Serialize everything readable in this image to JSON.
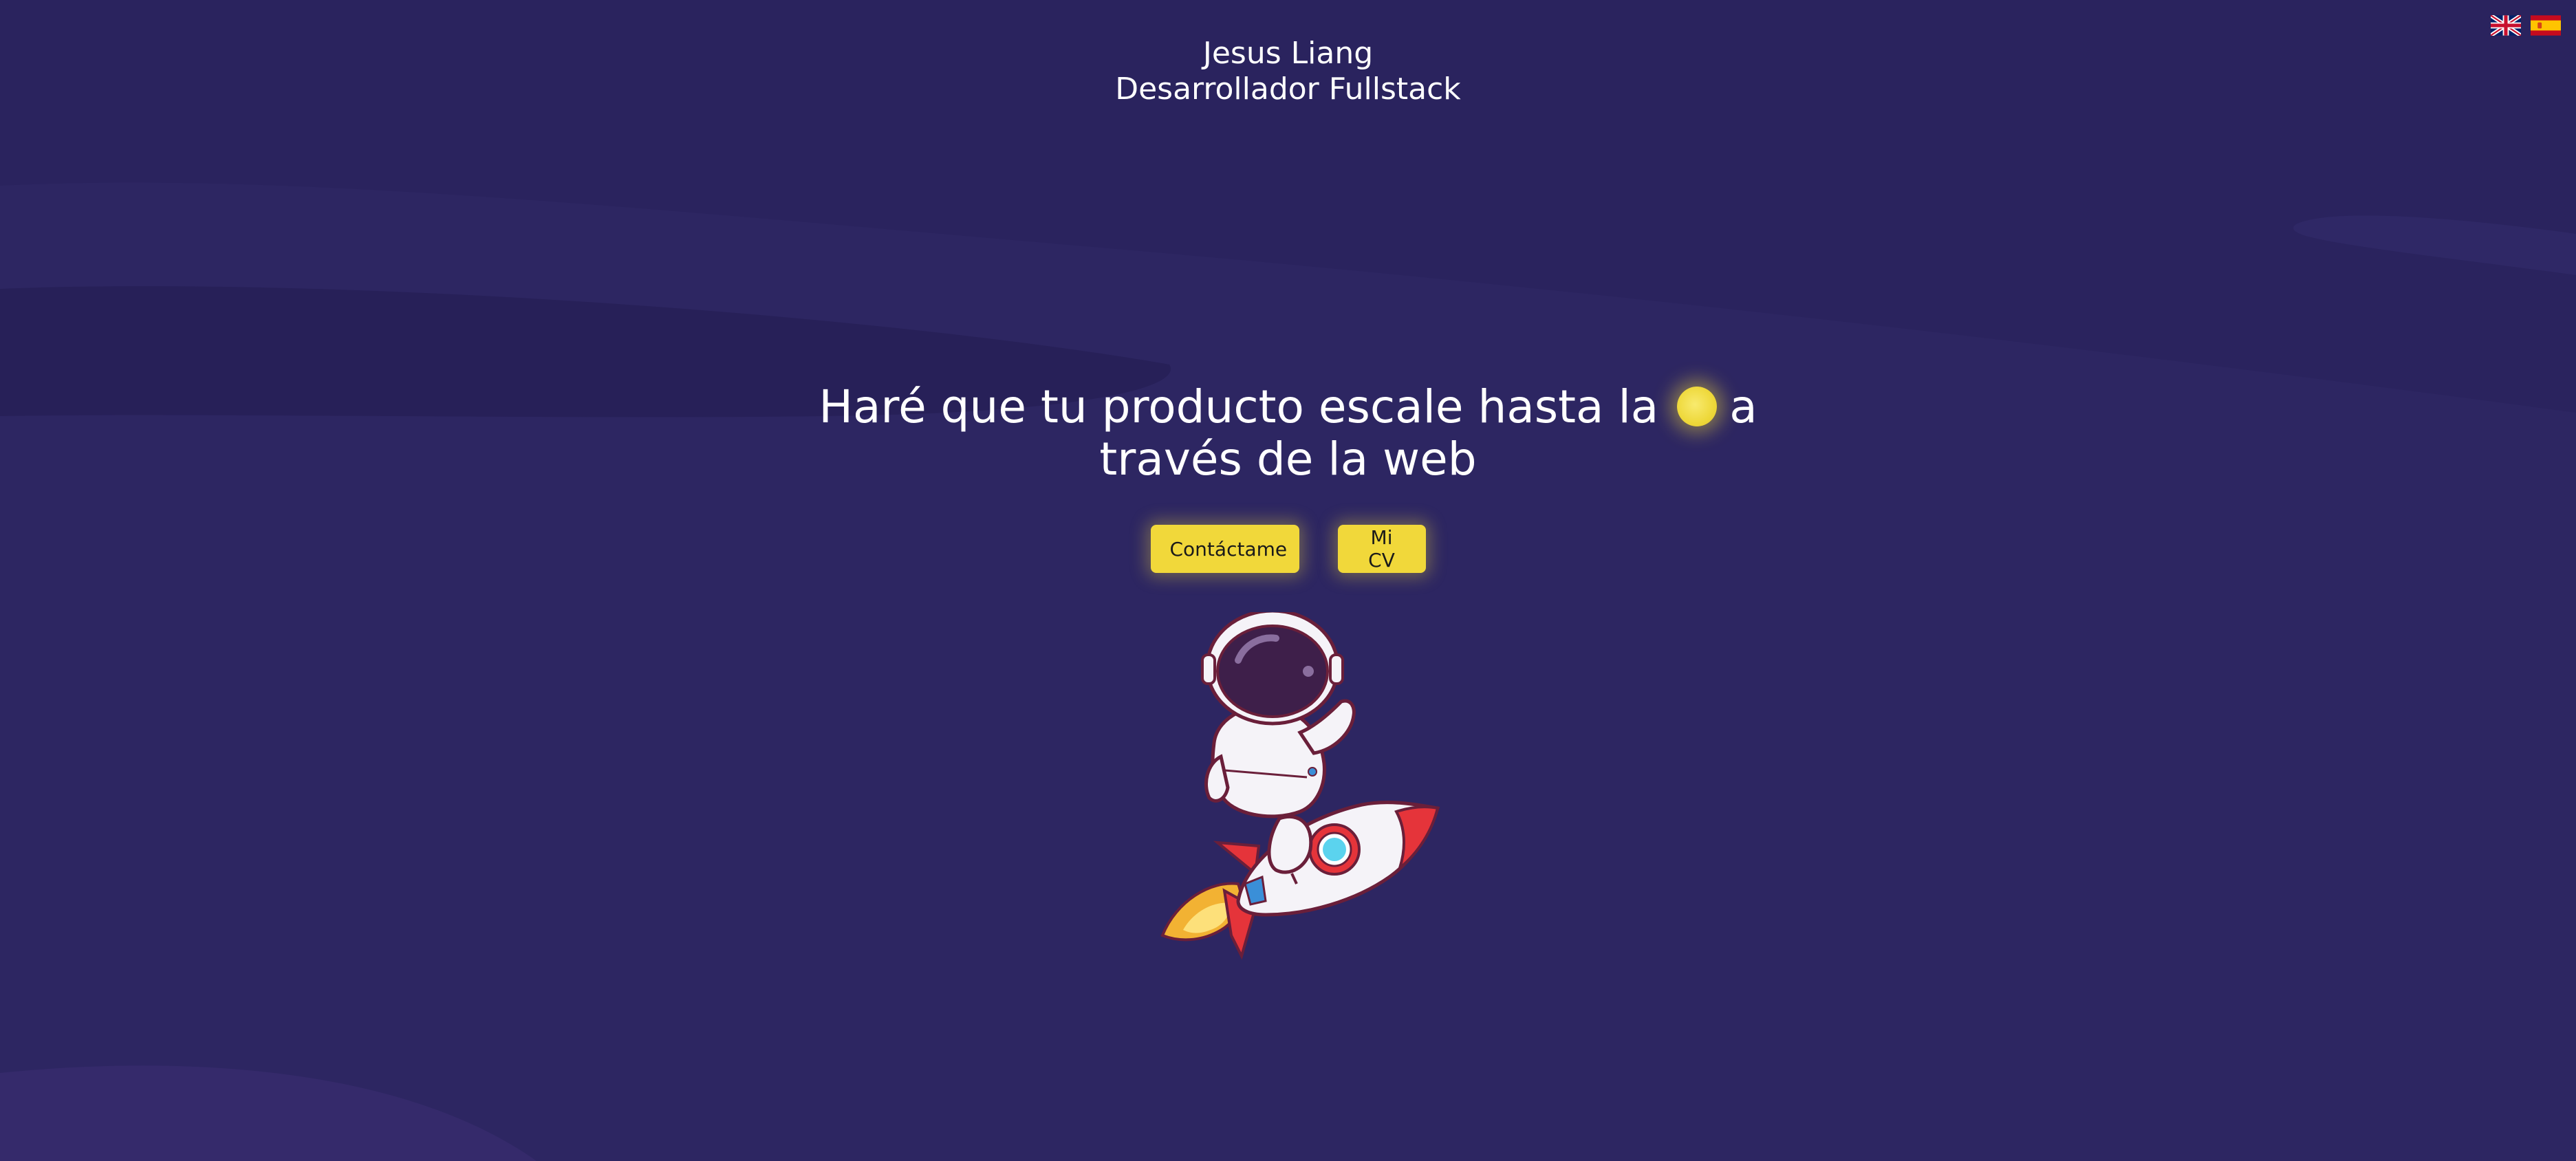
{
  "header": {
    "name": "Jesus Liang",
    "role": "Desarrollador Fullstack"
  },
  "language_switch": {
    "english_flag_icon": "uk-flag-icon",
    "spanish_flag_icon": "spain-flag-icon"
  },
  "hero": {
    "headline_part1": "Haré que tu producto escale hasta la",
    "headline_icon": "moon-icon",
    "headline_part2": "a",
    "headline_line2": "través de la web"
  },
  "buttons": {
    "contact_label": "Contáctame",
    "cv_label": "Mi CV"
  },
  "illustration": {
    "icon": "astronaut-on-rocket-illustration"
  },
  "colors": {
    "background": "#2a235e",
    "accent": "#f1d83a",
    "text": "#ffffff"
  }
}
